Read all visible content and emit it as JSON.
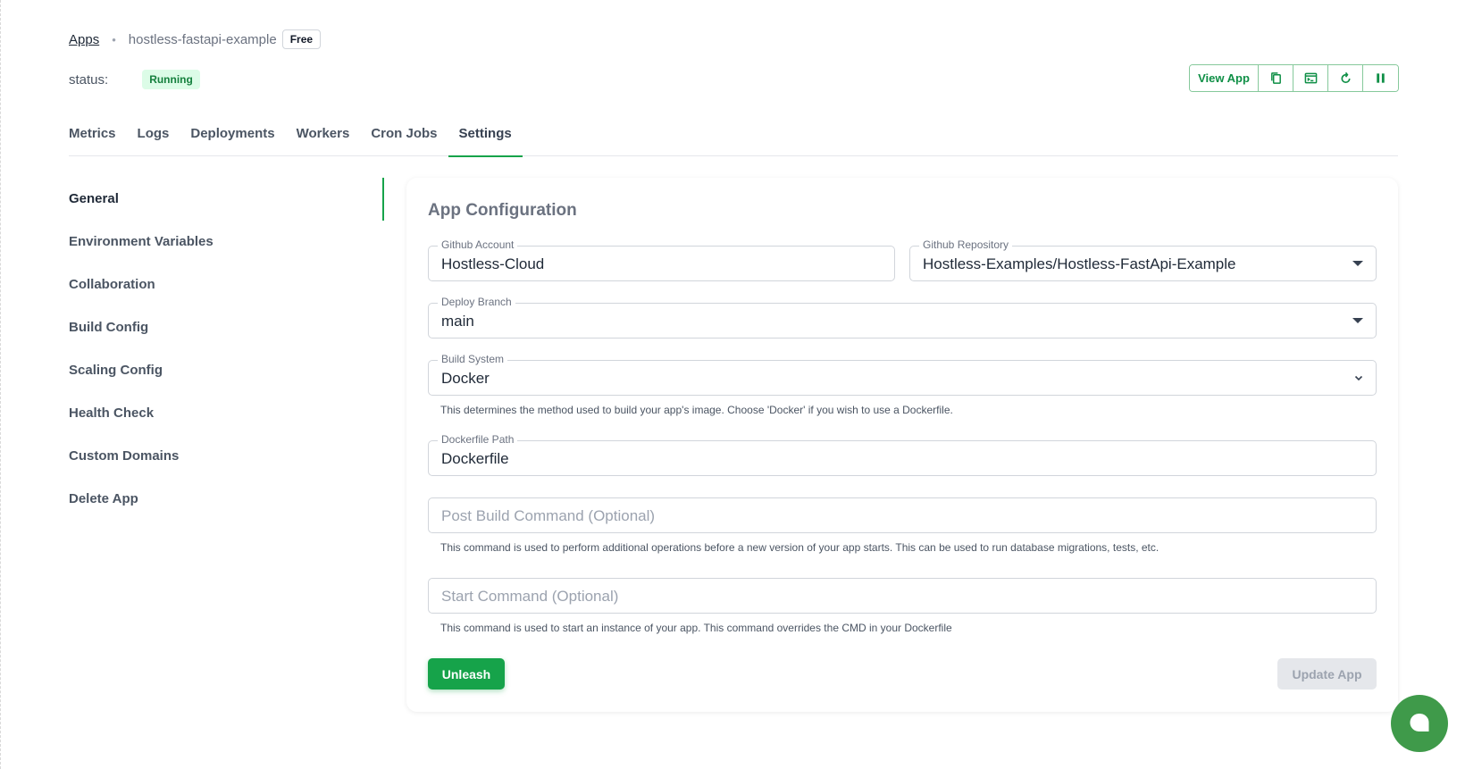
{
  "header": {
    "breadcrumb_root": "Apps",
    "app_name": "hostless-fastapi-example",
    "plan_badge": "Free",
    "status_label": "status:",
    "status_value": "Running"
  },
  "actions": {
    "view_app": "View App",
    "icons": [
      "copy-icon",
      "terminal-icon",
      "restart-icon",
      "pause-icon"
    ]
  },
  "tabs": [
    {
      "label": "Metrics"
    },
    {
      "label": "Logs"
    },
    {
      "label": "Deployments"
    },
    {
      "label": "Workers"
    },
    {
      "label": "Cron Jobs"
    },
    {
      "label": "Settings",
      "active": true
    }
  ],
  "sidebar": {
    "items": [
      {
        "label": "General",
        "active": true
      },
      {
        "label": "Environment Variables"
      },
      {
        "label": "Collaboration"
      },
      {
        "label": "Build Config"
      },
      {
        "label": "Scaling Config"
      },
      {
        "label": "Health Check"
      },
      {
        "label": "Custom Domains"
      },
      {
        "label": "Delete App"
      }
    ]
  },
  "config": {
    "title": "App Configuration",
    "github_account": {
      "label": "Github Account",
      "value": "Hostless-Cloud"
    },
    "github_repository": {
      "label": "Github Repository",
      "value": "Hostless-Examples/Hostless-FastApi-Example"
    },
    "deploy_branch": {
      "label": "Deploy Branch",
      "value": "main"
    },
    "build_system": {
      "label": "Build System",
      "value": "Docker",
      "helper": "This determines the method used to build your app's image. Choose 'Docker' if you wish to use a Dockerfile."
    },
    "dockerfile_path": {
      "label": "Dockerfile Path",
      "value": "Dockerfile"
    },
    "post_build_command": {
      "placeholder": "Post Build Command (Optional)",
      "helper": "This command is used to perform additional operations before a new version of your app starts. This can be used to run database migrations, tests, etc."
    },
    "start_command": {
      "placeholder": "Start Command (Optional)",
      "helper": "This command is used to start an instance of your app. This command overrides the CMD in your Dockerfile"
    },
    "unleash_label": "Unleash",
    "update_label": "Update App"
  },
  "colors": {
    "accent": "#16a34a",
    "status_bg": "#dcfce7",
    "status_text": "#15803d",
    "chat_fab": "#3f9a4a"
  }
}
